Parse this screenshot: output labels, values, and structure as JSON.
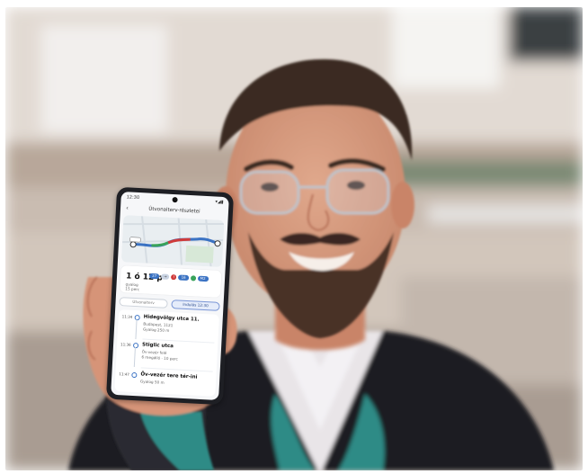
{
  "phone": {
    "status_time": "12:30",
    "status_icons": "▾◢▮",
    "app_title": "Útvonalterv-részletei",
    "back_icon": "‹",
    "summary": {
      "duration": "1 ó 12 p",
      "duration_sub": "gyalog\n15 perc"
    },
    "chips": [
      {
        "type": "blue",
        "text": "27"
      },
      {
        "type": "grey",
        "text": "→"
      },
      {
        "type": "red",
        "text": "!"
      },
      {
        "type": "blue",
        "text": "16"
      },
      {
        "type": "green",
        "text": ""
      },
      {
        "type": "blue",
        "text": "M2"
      }
    ],
    "buttons": [
      "Útvonalterv",
      "Indulás 12:30"
    ],
    "steps": [
      {
        "time": "11:34",
        "title": "Hidegvölgy utca 11.",
        "sub": "Budapest, 1121\nGyalog 250 m"
      },
      {
        "time": "11:36",
        "title": "Stiglic utca",
        "sub": "Öv-vezér felé\n6 megálló · 10 perc"
      },
      {
        "time": "11:47",
        "title": "Öv-vezér tere tér-ini",
        "sub": "Gyalog 50 m"
      }
    ]
  },
  "colors": {
    "route_blue": "#3a72c3",
    "route_red": "#cf3b3b",
    "route_green": "#39a35a",
    "jacket": "#1e1f24",
    "scarf": "#2f8b86"
  }
}
